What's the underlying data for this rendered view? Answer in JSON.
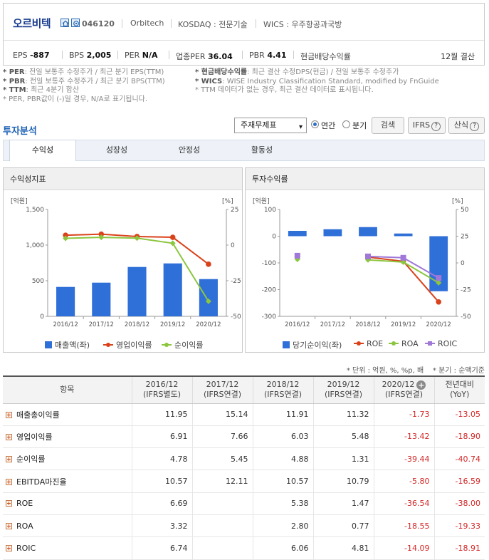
{
  "company": {
    "name": "오르비텍",
    "code": "046120",
    "english_name": "Orbitech",
    "market": "KOSDAQ : 전문기술",
    "wics": "WICS : 우주항공과국방"
  },
  "stats": {
    "eps_label": "EPS",
    "eps_value": "-887",
    "bps_label": "BPS",
    "bps_value": "2,005",
    "per_label": "PER",
    "per_value": "N/A",
    "industry_per_label": "업종PER",
    "industry_per_value": "36.04",
    "pbr_label": "PBR",
    "pbr_value": "4.41",
    "dividend_label": "현금배당수익률",
    "fiscal": "12월 결산"
  },
  "notes": {
    "per_key": "* PER",
    "per_text": ": 전일 보통주 수정주가 / 최근 분기 EPS(TTM)",
    "pbr_key": "* PBR",
    "pbr_text": ": 전일 보통주 수정주가 / 최근 분기 BPS(TTM)",
    "ttm_key": "* TTM",
    "ttm_text": ": 최근 4분기 합산",
    "neg_text": "* PER, PBR값이 (-)일 경우, N/A로 표기됩니다.",
    "div_key": "* 현금배당수익률",
    "div_text": ": 최근 결산 수정DPS(현금) / 전일 보통주 수정주가",
    "wics_key": "* WICS",
    "wics_text": ": WISE Industry Classification Standard, modified by FnGuide",
    "ttm_note": "* TTM 데이터가 없는 경우, 최근 결산 데이터로 표시됩니다."
  },
  "section": {
    "title": "투자분석",
    "select_value": "주재무제표",
    "radio_annual": "연간",
    "radio_quarter": "분기",
    "search_btn": "검색",
    "ifrs_btn": "IFRS",
    "formula_btn": "산식",
    "help": "?"
  },
  "tabs": [
    "수익성",
    "성장성",
    "안정성",
    "활동성"
  ],
  "colors": {
    "bar_blue": "#2f6fd8",
    "line_red": "#d9421a",
    "line_green": "#8cc63f",
    "line_purple": "#a078d8"
  },
  "charts": {
    "left_title": "수익성지표",
    "right_title": "투자수익률"
  },
  "chart_data": [
    {
      "type": "bar+line",
      "title": "수익성지표",
      "categories": [
        "2016/12",
        "2017/12",
        "2018/12",
        "2019/12",
        "2020/12"
      ],
      "y_left_label": "[억원]",
      "y_right_label": "[%]",
      "y_left_ticks": [
        "1,500",
        "1,000",
        "500",
        "0"
      ],
      "y_right_ticks": [
        "25",
        "0",
        "-25",
        "-50"
      ],
      "ylim_left": [
        0,
        1500
      ],
      "ylim_right": [
        -50,
        25
      ],
      "grid": false,
      "legend_position": "bottom",
      "series": [
        {
          "name": "매출액(좌)",
          "kind": "bar",
          "axis": "left",
          "color": "#2f6fd8",
          "values": [
            413,
            473,
            693,
            743,
            523
          ]
        },
        {
          "name": "영업이익률",
          "kind": "line",
          "axis": "right",
          "color": "#d9421a",
          "marker": "circle",
          "values": [
            6.91,
            7.66,
            6.03,
            5.48,
            -13.42
          ]
        },
        {
          "name": "순이익률",
          "kind": "line",
          "axis": "right",
          "color": "#8cc63f",
          "marker": "diamond",
          "values": [
            4.78,
            5.45,
            4.88,
            1.31,
            -39.44
          ]
        }
      ]
    },
    {
      "type": "bar+line",
      "title": "투자수익률",
      "categories": [
        "2016/12",
        "2017/12",
        "2018/12",
        "2019/12",
        "2020/12"
      ],
      "y_left_label": "[억원]",
      "y_right_label": "[%]",
      "y_left_ticks": [
        "100",
        "0",
        "-100",
        "-200",
        "-300"
      ],
      "y_right_ticks": [
        "50",
        "25",
        "0",
        "-25",
        "-50"
      ],
      "ylim_left": [
        -300,
        100
      ],
      "ylim_right": [
        -50,
        50
      ],
      "grid": false,
      "legend_position": "bottom",
      "series": [
        {
          "name": "당기순이익(좌)",
          "kind": "bar",
          "axis": "left",
          "color": "#2f6fd8",
          "values": [
            20,
            26,
            34,
            10,
            -206
          ]
        },
        {
          "name": "ROE",
          "kind": "line",
          "axis": "right",
          "color": "#d9421a",
          "marker": "circle",
          "values": [
            6.69,
            null,
            5.38,
            1.47,
            -36.54
          ]
        },
        {
          "name": "ROA",
          "kind": "line",
          "axis": "right",
          "color": "#8cc63f",
          "marker": "diamond",
          "values": [
            3.32,
            null,
            2.8,
            0.77,
            -18.55
          ]
        },
        {
          "name": "ROIC",
          "kind": "line",
          "axis": "right",
          "color": "#a078d8",
          "marker": "square",
          "values": [
            6.74,
            null,
            6.06,
            4.81,
            -14.09
          ]
        }
      ]
    }
  ],
  "table": {
    "unit_note": "* 단위 : 억원, %, %p, 배",
    "quarter_note": "* 분기 : 순액기준",
    "headers": [
      {
        "l1": "항목",
        "l2": ""
      },
      {
        "l1": "2016/12",
        "l2": "(IFRS별도)"
      },
      {
        "l1": "2017/12",
        "l2": "(IFRS연결)"
      },
      {
        "l1": "2018/12",
        "l2": "(IFRS연결)"
      },
      {
        "l1": "2019/12",
        "l2": "(IFRS연결)"
      },
      {
        "l1": "2020/12",
        "l2": "(IFRS연결)"
      },
      {
        "l1": "전년대비",
        "l2": "(YoY)"
      }
    ],
    "rows": [
      {
        "label": "매출총이익률",
        "cells": [
          "11.95",
          "15.14",
          "11.91",
          "11.32",
          "-1.73",
          "-13.05"
        ]
      },
      {
        "label": "영업이익률",
        "cells": [
          "6.91",
          "7.66",
          "6.03",
          "5.48",
          "-13.42",
          "-18.90"
        ]
      },
      {
        "label": "순이익률",
        "cells": [
          "4.78",
          "5.45",
          "4.88",
          "1.31",
          "-39.44",
          "-40.74"
        ]
      },
      {
        "label": "EBITDA마진율",
        "cells": [
          "10.57",
          "12.11",
          "10.57",
          "10.79",
          "-5.80",
          "-16.59"
        ]
      },
      {
        "label": "ROE",
        "cells": [
          "6.69",
          "",
          "5.38",
          "1.47",
          "-36.54",
          "-38.00"
        ]
      },
      {
        "label": "ROA",
        "cells": [
          "3.32",
          "",
          "2.80",
          "0.77",
          "-18.55",
          "-19.33"
        ]
      },
      {
        "label": "ROIC",
        "cells": [
          "6.74",
          "",
          "6.06",
          "4.81",
          "-14.09",
          "-18.91"
        ]
      }
    ]
  }
}
